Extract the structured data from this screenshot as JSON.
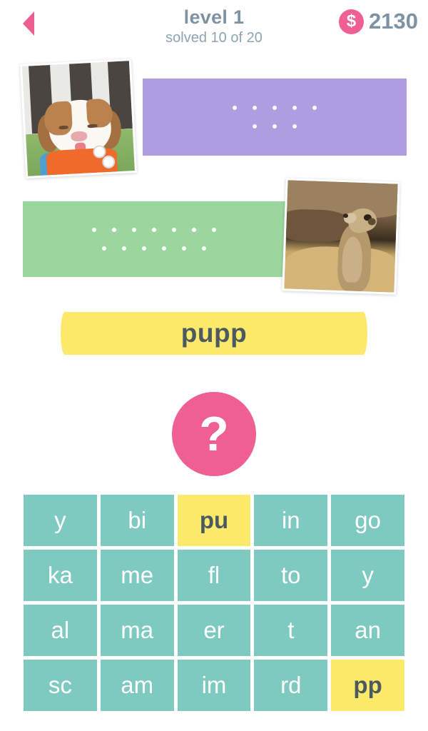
{
  "header": {
    "back_icon": "back-arrow-icon",
    "title": "level 1",
    "subtitle": "solved 10 of 20",
    "coin_icon": "dollar-coin-icon",
    "coin_symbol": "$",
    "coin_amount": "2130"
  },
  "puzzles": [
    {
      "id": "puzzle-1",
      "card_color": "#b09ce0",
      "photo": "puppy-photo",
      "photo_alt": "puppy with toy",
      "photo_side": "left",
      "dot_rows": [
        5,
        3
      ]
    },
    {
      "id": "puzzle-2",
      "card_color": "#9bd69e",
      "photo": "meerkat-photo",
      "photo_alt": "meerkat standing on sand",
      "photo_side": "right",
      "dot_rows": [
        7,
        6
      ]
    }
  ],
  "answer": {
    "text": "pupp",
    "background": "#fbe96b"
  },
  "hint": {
    "icon": "question-mark-icon",
    "label": "?",
    "background": "#ef5f92"
  },
  "tiles": {
    "tile_color": "#7ecac1",
    "selected_color": "#fbe96b",
    "items": [
      {
        "label": "y",
        "used": false
      },
      {
        "label": "bi",
        "used": false
      },
      {
        "label": "pu",
        "used": true
      },
      {
        "label": "in",
        "used": false
      },
      {
        "label": "go",
        "used": false
      },
      {
        "label": "ka",
        "used": false
      },
      {
        "label": "me",
        "used": false
      },
      {
        "label": "fl",
        "used": false
      },
      {
        "label": "to",
        "used": false
      },
      {
        "label": "y",
        "used": false
      },
      {
        "label": "al",
        "used": false
      },
      {
        "label": "ma",
        "used": false
      },
      {
        "label": "er",
        "used": false
      },
      {
        "label": "t",
        "used": false
      },
      {
        "label": "an",
        "used": false
      },
      {
        "label": "sc",
        "used": false
      },
      {
        "label": "am",
        "used": false
      },
      {
        "label": "im",
        "used": false
      },
      {
        "label": "rd",
        "used": false
      },
      {
        "label": "pp",
        "used": true
      }
    ]
  },
  "colors": {
    "accent_pink": "#ef5f92",
    "text_gray": "#7d93a3",
    "purple_card": "#b09ce0",
    "green_card": "#9bd69e",
    "teal_tile": "#7ecac1",
    "yellow": "#fbe96b"
  }
}
